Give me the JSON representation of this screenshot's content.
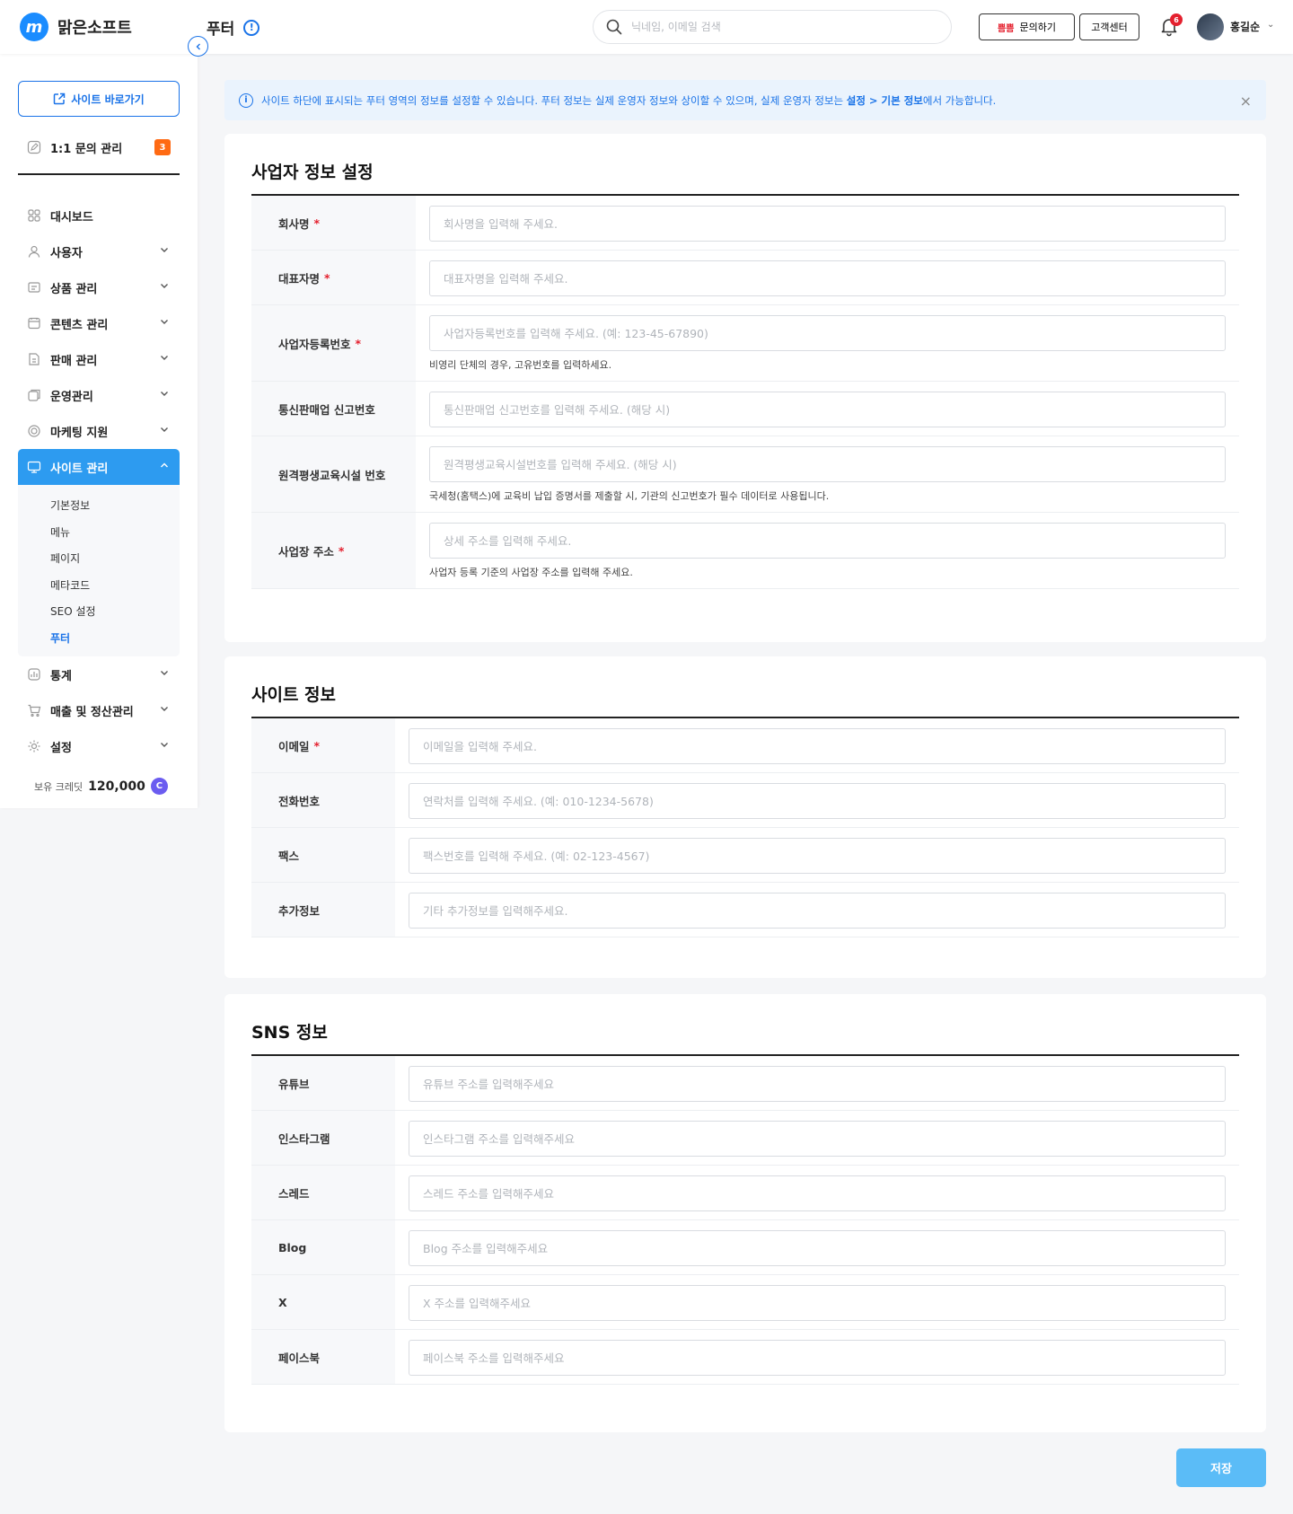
{
  "header": {
    "brand": "맑은소프트",
    "logo_letter": "m",
    "page_title": "푸터",
    "search_placeholder": "닉네임, 이메일 검색",
    "inquiry_brand": "쁨쁨",
    "inquiry_label": "문의하기",
    "support_label": "고객센터",
    "notification_count": "6",
    "user_name": "홍길순"
  },
  "sidebar": {
    "site_button": "사이트 바로가기",
    "qna_label": "1:1 문의 관리",
    "qna_count": "3",
    "items": [
      {
        "label": "대시보드",
        "icon": "dashboard-icon",
        "chevron": false
      },
      {
        "label": "사용자",
        "icon": "user-icon",
        "chevron": true
      },
      {
        "label": "상품 관리",
        "icon": "product-icon",
        "chevron": true
      },
      {
        "label": "콘텐츠 관리",
        "icon": "content-icon",
        "chevron": true
      },
      {
        "label": "판매 관리",
        "icon": "sales-icon",
        "chevron": true
      },
      {
        "label": "운영관리",
        "icon": "operation-icon",
        "chevron": true
      },
      {
        "label": "마케팅 지원",
        "icon": "marketing-icon",
        "chevron": true
      },
      {
        "label": "사이트 관리",
        "icon": "site-icon",
        "chevron": true,
        "active": true
      },
      {
        "label": "통계",
        "icon": "stats-icon",
        "chevron": true
      },
      {
        "label": "매출 및 정산관리",
        "icon": "cart-icon",
        "chevron": true
      },
      {
        "label": "설정",
        "icon": "settings-icon",
        "chevron": true
      }
    ],
    "submenu": [
      "기본정보",
      "메뉴",
      "페이지",
      "메타코드",
      "SEO 설정",
      "푸터"
    ],
    "submenu_current": "푸터",
    "credit_label": "보유 크레딧",
    "credit_value": "120,000",
    "credit_symbol": "C"
  },
  "notice": {
    "text_before": "사이트 하단에 표시되는 푸터 영역의 정보를 설정할 수 있습니다. 푸터 정보는 실제 운영자 정보와 상이할 수 있으며, 실제 운영자 정보는 ",
    "path": "설정 > 기본 정보",
    "text_after": "에서 가능합니다.",
    "close": "×"
  },
  "business": {
    "title": "사업자 정보 설정",
    "fields": [
      {
        "label": "회사명",
        "required": true,
        "placeholder": "회사명을 입력해 주세요.",
        "help": ""
      },
      {
        "label": "대표자명",
        "required": true,
        "placeholder": "대표자명을 입력해 주세요.",
        "help": ""
      },
      {
        "label": "사업자등록번호",
        "required": true,
        "placeholder": "사업자등록번호를 입력해 주세요. (예: 123-45-67890)",
        "help": "비영리 단체의 경우, 고유번호를 입력하세요."
      },
      {
        "label": "통신판매업 신고번호",
        "required": false,
        "placeholder": "통신판매업 신고번호를 입력해 주세요. (해당 시)",
        "help": ""
      },
      {
        "label": "원격평생교육시설 번호",
        "required": false,
        "placeholder": "원격평생교육시설번호를 입력해 주세요. (해당 시)",
        "help": "국세청(홈택스)에 교육비 납입 증명서를 제출할 시, 기관의 신고번호가 필수 데이터로 사용됩니다."
      },
      {
        "label": "사업장 주소",
        "required": true,
        "placeholder": "상세 주소를 입력해 주세요.",
        "help": "사업자 등록 기준의 사업장 주소를 입력해 주세요."
      }
    ]
  },
  "site": {
    "title": "사이트 정보",
    "fields": [
      {
        "label": "이메일",
        "required": true,
        "placeholder": "이메일을 입력해 주세요."
      },
      {
        "label": "전화번호",
        "required": false,
        "placeholder": "연락처를 입력해 주세요. (예: 010-1234-5678)"
      },
      {
        "label": "팩스",
        "required": false,
        "placeholder": "팩스번호를 입력해 주세요. (예: 02-123-4567)"
      },
      {
        "label": "추가정보",
        "required": false,
        "placeholder": "기타 추가정보를 입력해주세요."
      }
    ]
  },
  "sns": {
    "title": "SNS 정보",
    "fields": [
      {
        "label": "유튜브",
        "placeholder": "유튜브 주소를 입력해주세요"
      },
      {
        "label": "인스타그램",
        "placeholder": "인스타그램 주소를 입력해주세요"
      },
      {
        "label": "스레드",
        "placeholder": "스레드 주소를 입력해주세요"
      },
      {
        "label": "Blog",
        "placeholder": "Blog 주소를 입력해주세요"
      },
      {
        "label": "X",
        "placeholder": "X 주소를 입력해주세요"
      },
      {
        "label": "페이스북",
        "placeholder": "페이스북 주소를 입력해주세요"
      }
    ]
  },
  "actions": {
    "save_label": "저장"
  },
  "colors": {
    "accent": "#1a73e8",
    "active_menu": "#2d9bf0",
    "required": "#e4202e",
    "save_button": "#5bbcf7",
    "badge": "#ff6a13"
  }
}
